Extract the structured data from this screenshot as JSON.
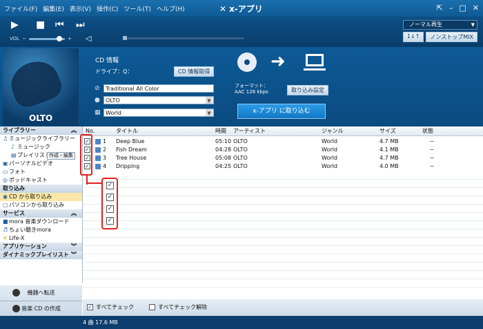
{
  "menu": [
    "ファイル(F)",
    "編集(E)",
    "表示(V)",
    "操作(C)",
    "ツール(T)",
    "ヘルプ(H)"
  ],
  "app_title": "x-アプリ",
  "player": {
    "vol_label": "VOL",
    "play_mode": "ノーマル再生",
    "mix_button": "ノンストップMIX",
    "shuffle_button": "1↓↑"
  },
  "cd": {
    "title": "CD 情報",
    "drive": "ドライブ：Q：",
    "get_info_button": "CD 情報取得",
    "album": "Traditional All Color",
    "artist": "OLTO",
    "genre": "World",
    "format_label": "フォーマット：",
    "format_value": "AAC 128 kbps",
    "import_settings_button": "取り込み設定",
    "import_button": "x-アプリ に取り込む",
    "art_label": "OLTO"
  },
  "sidebar": {
    "library": "ライブラリー",
    "music_library": "ミュージックライブラリー",
    "music": "ミュージック",
    "playlist": "プレイリスト",
    "edit_button": "作成・編集",
    "personal_video": "パーソナルビデオ",
    "photo": "フォト",
    "podcast": "ポッドキャスト",
    "import": "取り込み",
    "import_cd": "CD から取り込み",
    "import_pc": "パソコンから取り込み",
    "service": "サービス",
    "mora_download": "mora 音楽ダウンロード",
    "mora_listen": "ちょい聴きmora",
    "lifex": "Life-X",
    "application": "アプリケーション",
    "dynamic_playlist": "ダイナミックプレイリスト",
    "transfer_button": "機器へ転送",
    "make_cd_button": "音楽 CD の作成"
  },
  "columns": {
    "no": "No.",
    "title": "タイトル",
    "time": "時間",
    "artist": "アーティスト",
    "genre": "ジャンル",
    "size": "サイズ",
    "status": "状態"
  },
  "tracks": [
    {
      "no": "1",
      "title": "Deep Blue",
      "time": "05:10",
      "artist": "OLTO",
      "genre": "World",
      "size": "4.7 MB",
      "status": "－"
    },
    {
      "no": "2",
      "title": "Fish Dream",
      "time": "04:28",
      "artist": "OLTO",
      "genre": "World",
      "size": "4.1 MB",
      "status": "－"
    },
    {
      "no": "3",
      "title": "Tree House",
      "time": "05:08",
      "artist": "OLTO",
      "genre": "World",
      "size": "4.7 MB",
      "status": "－"
    },
    {
      "no": "4",
      "title": "Dripping",
      "time": "04:25",
      "artist": "OLTO",
      "genre": "World",
      "size": "4.0 MB",
      "status": "－"
    }
  ],
  "footer": {
    "check_all": "すべてチェック",
    "uncheck_all": "すべてチェック解除"
  },
  "status": "4 曲  17.6 MB",
  "colors": {
    "accent": "#0b4b80",
    "highlight": "#e02020",
    "selected": "#fbe8a8"
  }
}
